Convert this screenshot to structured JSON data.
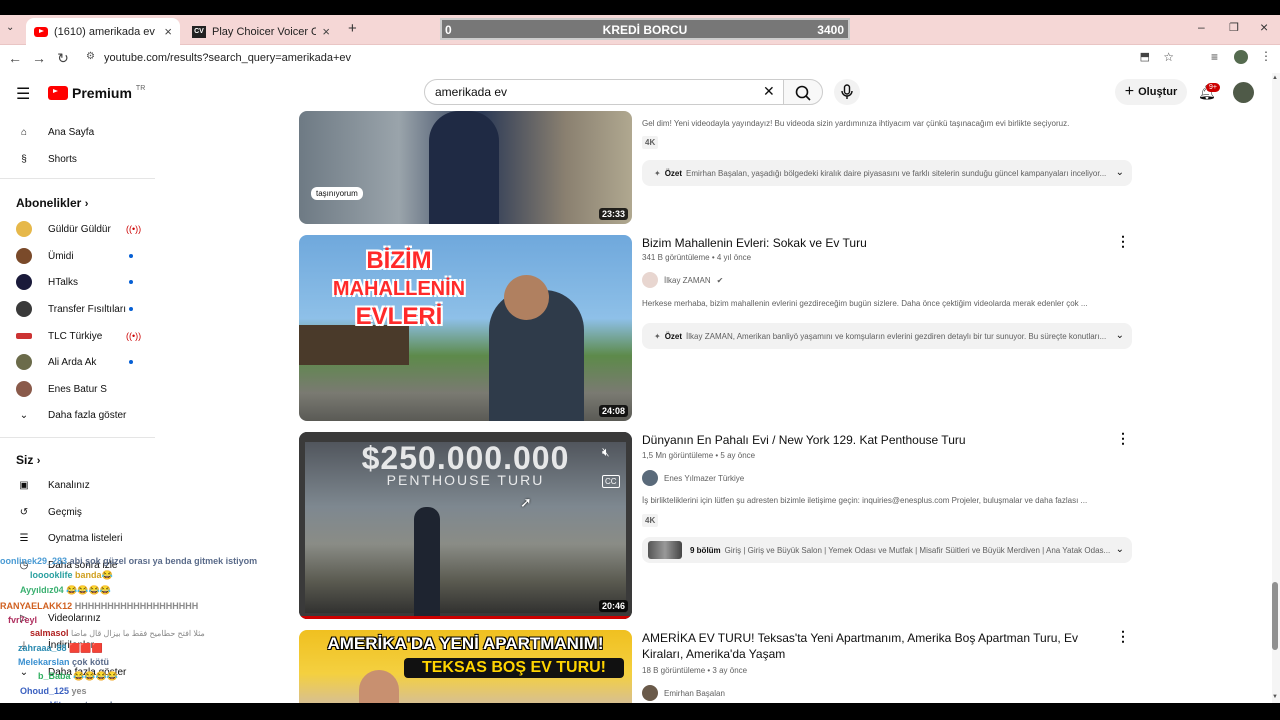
{
  "browser": {
    "tabs": [
      {
        "label": "(1610) amerikada ev - YouTube"
      },
      {
        "label": "Play Choicer Voicer Online Free"
      }
    ],
    "url": "youtube.com/results?search_query=amerikada+ev"
  },
  "overlay": {
    "left": "0",
    "title": "KREDİ BORCU",
    "right": "3400"
  },
  "header": {
    "logo": "Premium",
    "region": "TR",
    "search_value": "amerikada ev",
    "create_label": "Oluştur",
    "notif_count": "9+"
  },
  "sidebar": {
    "top": [
      {
        "label": "Ana Sayfa"
      },
      {
        "label": "Shorts"
      }
    ],
    "subs_title": "Abonelikler",
    "subs": [
      {
        "label": "Güldür Güldür"
      },
      {
        "label": "Ümidi"
      },
      {
        "label": "HTalks"
      },
      {
        "label": "Transfer Fısıltıları"
      },
      {
        "label": "TLC Türkiye"
      },
      {
        "label": "Ali Arda Ak"
      },
      {
        "label": "Enes Batur S"
      }
    ],
    "show_more": "Daha fazla göster",
    "you_title": "Siz",
    "you": [
      {
        "label": "Kanalınız"
      },
      {
        "label": "Geçmiş"
      },
      {
        "label": "Oynatma listeleri"
      },
      {
        "label": "Daha sonra izle"
      },
      {
        "label": "Videolarınız"
      },
      {
        "label": "İndirilenler"
      },
      {
        "label": "Daha fazla göster"
      }
    ]
  },
  "results": [
    {
      "desc": "Gel dim! Yeni videodayla yayındayız! Bu videoda sizin yardımınıza ihtiyacım var çünkü taşınacağım evi birlikte seçiyoruz.",
      "badge": "4K",
      "summary_label": "Özet",
      "summary": "Emirhan Başalan, yaşadığı bölgedeki kiralık daire piyasasını ve farklı sitelerin sunduğu güncel kampanyaları inceliyor...",
      "duration": "23:33",
      "thumb_tag": "taşınıyorum"
    },
    {
      "title": "Bizim Mahallenin Evleri: Sokak ve Ev Turu",
      "meta": "341 B görüntüleme • 4 yıl önce",
      "channel": "İlkay ZAMAN",
      "desc": "Herkese merhaba, bizim mahallenin evlerini gezdireceğim bugün sizlere. Daha önce çektiğim videolarda merak edenler çok ...",
      "summary_label": "Özet",
      "summary": "İlkay ZAMAN, Amerikan banliyö yaşamını ve komşuların evlerini gezdiren detaylı bir tur sunuyor. Bu süreçte konutları...",
      "duration": "24:08",
      "thumb_text1": "BİZİM",
      "thumb_text2": "MAHALLENİN",
      "thumb_text3": "EVLERİ"
    },
    {
      "title": "Dünyanın En Pahalı Evi / New York 129. Kat Penthouse Turu",
      "meta": "1,5 Mn görüntüleme • 5 ay önce",
      "channel": "Enes Yılmazer Türkiye",
      "desc": "İş birlikteliklerini için lütfen şu adresten bizimle iletişime geçin: inquiries@enesplus.com Projeler, buluşmalar ve daha fazlası ...",
      "badge": "4K",
      "chapters_count": "9 bölüm",
      "chapters": "Giriş | Giriş ve Büyük Salon | Yemek Odası ve Mutfak | Misafir Süitleri ve Büyük Merdiven | Ana Yatak Odas...",
      "duration": "20:46",
      "thumb_text1": "$250.000.000",
      "thumb_text2": "PENTHOUSE TURU",
      "thumb_cc": "CC"
    },
    {
      "title": "AMERİKA EV TURU! Teksas'ta Yeni Apartmanım, Amerika Boş Apartman Turu, Ev Kiraları, Amerika'da Yaşam",
      "meta": "18 B görüntüleme • 3 ay önce",
      "channel": "Emirhan Başalan",
      "thumb_text1": "AMERİKA'DA YENİ APARTMANIM!",
      "thumb_text2": "TEKSAS BOŞ EV TURU!"
    }
  ],
  "chat": [
    {
      "user": "oonlinek29_283",
      "msg": "abi şok güzel orası ya benda gitmek istiyom"
    },
    {
      "user": "looooklife",
      "msg": "banda😂"
    },
    {
      "user": "Ayyıldız04",
      "msg": "😂😂😂😂"
    },
    {
      "user": "RANYAELAKK12",
      "msg": "HHHHHHHHHHHHHHHHHHH"
    },
    {
      "user": "fvr7eyl",
      "msg": ""
    },
    {
      "user": "salmasol",
      "msg": "مثلا افتح حطاميح فقط ما بيزال قال ماضا"
    },
    {
      "user": "zahraaa_88",
      "msg": "🟥🟥🟥"
    },
    {
      "user": "Melekarslan",
      "msg": "çok kötü"
    },
    {
      "user": "b_Baba",
      "msg": "😂😂😂😂"
    },
    {
      "user": "Ohoud_125",
      "msg": "yes"
    },
    {
      "user": "s_Vitae",
      "msg": "not good"
    }
  ]
}
